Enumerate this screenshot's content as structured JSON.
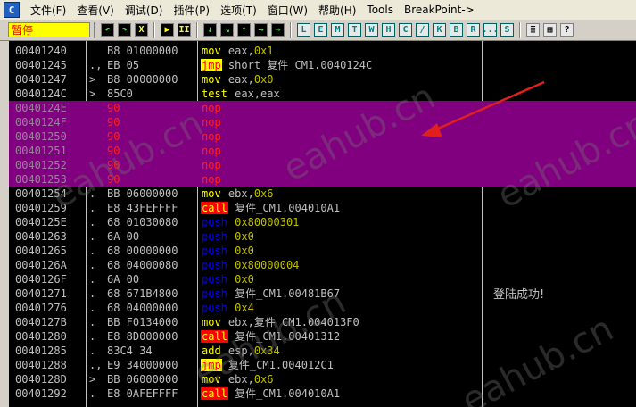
{
  "menu": {
    "app_icon": "C",
    "items": [
      "文件(F)",
      "查看(V)",
      "调试(D)",
      "插件(P)",
      "选项(T)",
      "窗口(W)",
      "帮助(H)",
      "Tools",
      "BreakPoint->"
    ]
  },
  "toolbar": {
    "status": "暂停",
    "buttons": [
      "↶",
      "↷",
      "X",
      "▶",
      "II",
      "↓",
      "↘",
      "↑",
      "→",
      "⇒"
    ],
    "letter_buttons": [
      "L",
      "E",
      "M",
      "T",
      "W",
      "H",
      "C",
      "/",
      "K",
      "B",
      "R",
      "...",
      "S"
    ],
    "grid_buttons": [
      "≣",
      "▦",
      "?"
    ]
  },
  "rows": [
    {
      "addr": "00401240",
      "mark": "",
      "hex": "B8 01000000",
      "mn": "mov",
      "mnclass": "",
      "op": "eax,",
      "num": "0x1"
    },
    {
      "addr": "00401245",
      "mark": ".,",
      "hex": "EB 05",
      "mn": "jmp",
      "mnclass": "jmp",
      "op": "short 复件_CM1.0040124C",
      "num": ""
    },
    {
      "addr": "00401247",
      "mark": ">",
      "hex": "B8 00000000",
      "mn": "mov",
      "mnclass": "",
      "op": "eax,",
      "num": "0x0"
    },
    {
      "addr": "0040124C",
      "mark": ">",
      "hex": "85C0",
      "mn": "test",
      "mnclass": "test",
      "op": "eax,eax",
      "num": ""
    },
    {
      "addr": "0040124E",
      "mark": "",
      "hex": "90",
      "mn": "nop",
      "mnclass": "nop",
      "op": "",
      "num": "",
      "sel": true
    },
    {
      "addr": "0040124F",
      "mark": "",
      "hex": "90",
      "mn": "nop",
      "mnclass": "nop",
      "op": "",
      "num": "",
      "sel": true
    },
    {
      "addr": "00401250",
      "mark": "",
      "hex": "90",
      "mn": "nop",
      "mnclass": "nop",
      "op": "",
      "num": "",
      "sel": true
    },
    {
      "addr": "00401251",
      "mark": "",
      "hex": "90",
      "mn": "nop",
      "mnclass": "nop",
      "op": "",
      "num": "",
      "sel": true
    },
    {
      "addr": "00401252",
      "mark": "",
      "hex": "90",
      "mn": "nop",
      "mnclass": "nop",
      "op": "",
      "num": "",
      "sel": true
    },
    {
      "addr": "00401253",
      "mark": "",
      "hex": "90",
      "mn": "nop",
      "mnclass": "nop",
      "op": "",
      "num": "",
      "sel": true
    },
    {
      "addr": "00401254",
      "mark": ".",
      "hex": "BB 06000000",
      "mn": "mov",
      "mnclass": "",
      "op": "ebx,",
      "num": "0x6"
    },
    {
      "addr": "00401259",
      "mark": ".",
      "hex": "E8 43FEFFFF",
      "mn": "call",
      "mnclass": "call",
      "op": "复件_CM1.004010A1",
      "num": ""
    },
    {
      "addr": "0040125E",
      "mark": ".",
      "hex": "68 01030080",
      "mn": "push",
      "mnclass": "push",
      "op": "",
      "num": "0x80000301"
    },
    {
      "addr": "00401263",
      "mark": ".",
      "hex": "6A 00",
      "mn": "push",
      "mnclass": "push",
      "op": "",
      "num": "0x0"
    },
    {
      "addr": "00401265",
      "mark": ".",
      "hex": "68 00000000",
      "mn": "push",
      "mnclass": "push",
      "op": "",
      "num": "0x0"
    },
    {
      "addr": "0040126A",
      "mark": ".",
      "hex": "68 04000080",
      "mn": "push",
      "mnclass": "push",
      "op": "",
      "num": "0x80000004"
    },
    {
      "addr": "0040126F",
      "mark": ".",
      "hex": "6A 00",
      "mn": "push",
      "mnclass": "push",
      "op": "",
      "num": "0x0"
    },
    {
      "addr": "00401271",
      "mark": ".",
      "hex": "68 671B4800",
      "mn": "push",
      "mnclass": "push",
      "op": "复件_CM1.00481B67",
      "num": ""
    },
    {
      "addr": "00401276",
      "mark": ".",
      "hex": "68 04000000",
      "mn": "push",
      "mnclass": "push",
      "op": "",
      "num": "0x4"
    },
    {
      "addr": "0040127B",
      "mark": ".",
      "hex": "BB F0134000",
      "mn": "mov",
      "mnclass": "",
      "op": "ebx,复件_CM1.004013F0",
      "num": ""
    },
    {
      "addr": "00401280",
      "mark": ".",
      "hex": "E8 8D000000",
      "mn": "call",
      "mnclass": "call",
      "op": "复件_CM1.00401312",
      "num": ""
    },
    {
      "addr": "00401285",
      "mark": ".",
      "hex": "83C4 34",
      "mn": "add",
      "mnclass": "",
      "op": "esp,",
      "num": "0x34"
    },
    {
      "addr": "00401288",
      "mark": ".,",
      "hex": "E9 34000000",
      "mn": "jmp",
      "mnclass": "jmp",
      "op": "复件_CM1.004012C1",
      "num": ""
    },
    {
      "addr": "0040128D",
      "mark": ">",
      "hex": "BB 06000000",
      "mn": "mov",
      "mnclass": "",
      "op": "ebx,",
      "num": "0x6"
    },
    {
      "addr": "00401292",
      "mark": ".",
      "hex": "E8 0AFEFFFF",
      "mn": "call",
      "mnclass": "call",
      "op": "复件_CM1.004010A1",
      "num": ""
    }
  ],
  "comment": "登陆成功!",
  "watermark": "eahub.cn",
  "colors": {
    "selection": "#800080",
    "call_bg": "#ff0000",
    "jmp_bg": "#ffff00",
    "push": "#0000ff",
    "arrow": "#e02020"
  }
}
